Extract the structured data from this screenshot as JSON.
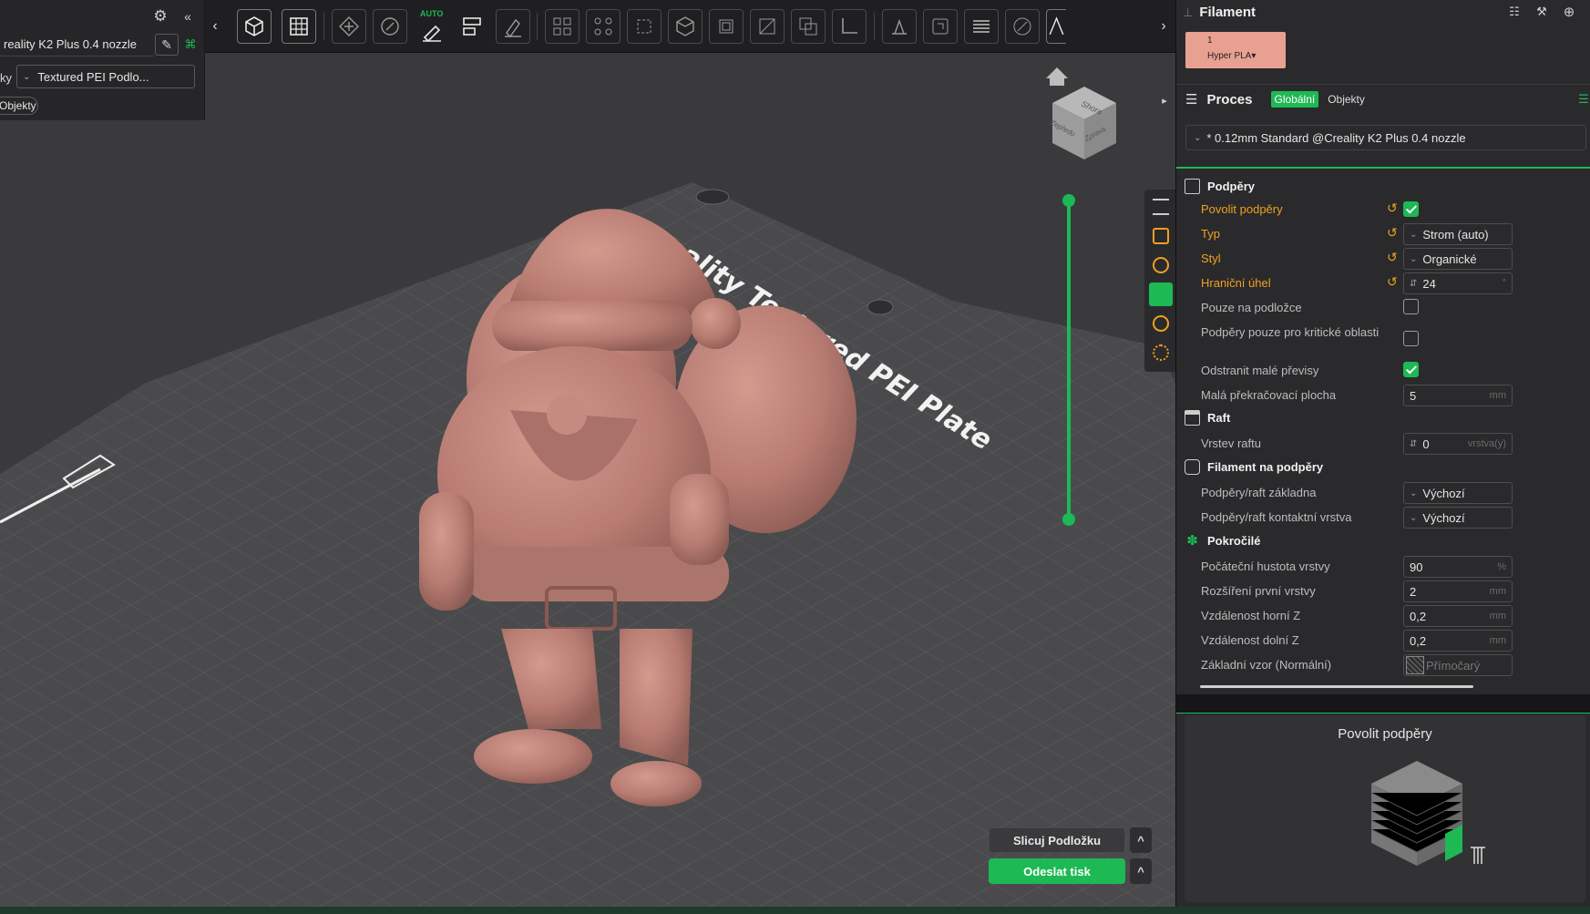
{
  "left_panel": {
    "printer": "reality K2 Plus 0.4 nozzle",
    "plate_prefix": "ky",
    "plate": "Textured PEI Podlo...",
    "objects_tab": "Objekty"
  },
  "toolbar": {
    "auto_badge": "AUTO",
    "items": [
      "add-object",
      "plate-grid",
      "arrange",
      "orient",
      "auto-orient",
      "split",
      "paint",
      "arrange-grid",
      "layout",
      "cut",
      "boolean",
      "support-paint",
      "seam",
      "measure",
      "text",
      "emboss",
      "assembly",
      "layers",
      "color-paint",
      "font"
    ]
  },
  "viewport": {
    "plate_label": "ality Textured PEI Plate",
    "navcube": {
      "top": "Shora",
      "front": "Zepředu",
      "right": "Zprava"
    }
  },
  "actions": {
    "slice": "Slicuj Podložku",
    "send": "Odeslat tisk",
    "caret": "^"
  },
  "filament": {
    "title": "Filament",
    "slot_number": "1",
    "slot_name": "Hyper PLA▾",
    "slot_color": "#e8a090"
  },
  "process": {
    "title": "Proces",
    "tab_global": "Globální",
    "tab_objects": "Objekty",
    "preset": "* 0.12mm Standard @Creality K2 Plus 0.4 nozzle"
  },
  "sections": {
    "supports": "Podpěry",
    "raft": "Raft",
    "filament_for_supports": "Filament na podpěry",
    "advanced": "Pokročilé"
  },
  "settings": {
    "enable_supports": "Povolit podpěry",
    "type": "Typ",
    "type_value": "Strom (auto)",
    "style": "Styl",
    "style_value": "Organické",
    "threshold": "Hraniční úhel",
    "threshold_value": "24",
    "on_build_plate": "Pouze na podložce",
    "critical_only": "Podpěry pouze pro kritické oblasti",
    "remove_small": "Odstranit malé převisy",
    "small_area": "Malá překračovací plocha",
    "small_area_value": "5",
    "raft_layers": "Vrstev raftu",
    "raft_layers_value": "0",
    "raft_unit": "vrstva(y)",
    "base_filament": "Podpěry/raft základna",
    "base_filament_value": "Výchozí",
    "interface_filament": "Podpěry/raft kontaktní vrstva",
    "interface_filament_value": "Výchozí",
    "initial_density": "Počáteční hustota vrstvy",
    "initial_density_value": "90",
    "first_expansion": "Rozšíření první vrstvy",
    "first_expansion_value": "2",
    "top_z": "Vzdálenost horní Z",
    "top_z_value": "0,2",
    "bottom_z": "Vzdálenost dolní Z",
    "bottom_z_value": "0,2",
    "base_pattern": "Základní vzor (Normální)",
    "base_pattern_value": "Přímočarý",
    "unit_mm": "mm",
    "unit_pct": "%"
  },
  "preview": {
    "title": "Povolit podpěry"
  },
  "colors": {
    "accent": "#1db954",
    "modified": "#f0a020",
    "model": "#c0837a"
  }
}
